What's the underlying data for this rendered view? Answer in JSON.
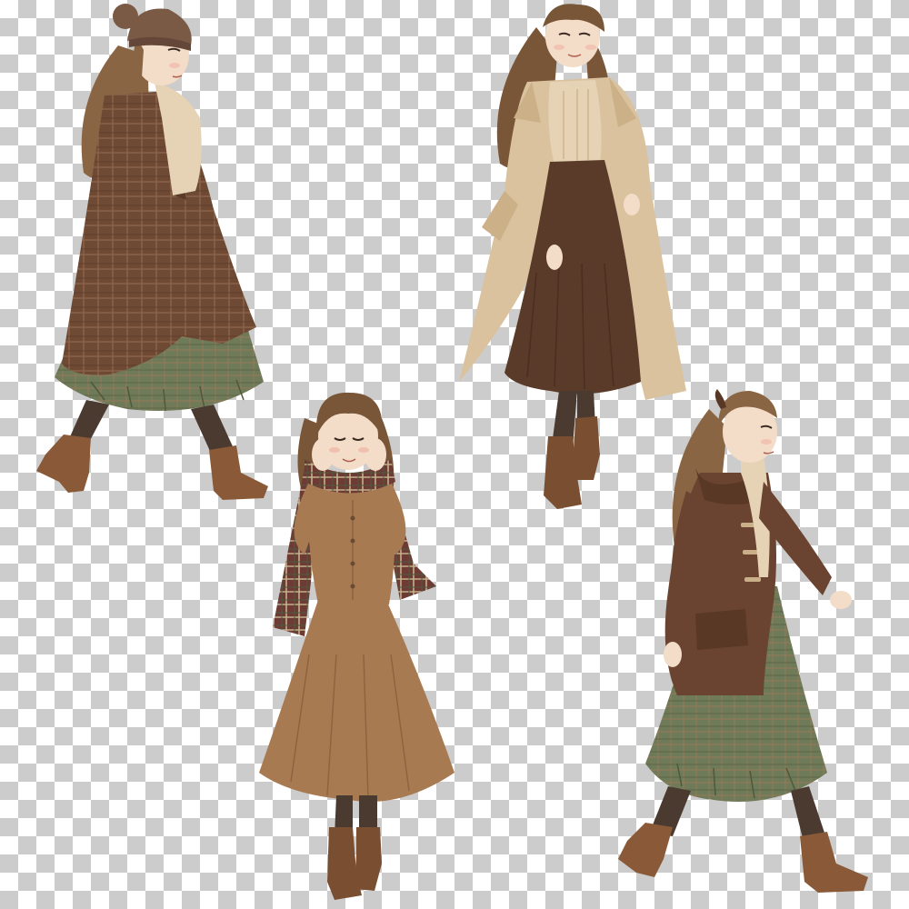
{
  "canvas": {
    "background": "transparency-checkerboard",
    "checker_colors": [
      "#ffffff",
      "#cccccc"
    ]
  },
  "figures": [
    {
      "id": "figure-plaid-coat-beanie",
      "pose": "walking-left",
      "items": [
        "knit-beanie",
        "plaid-wool-coat",
        "cream-sweater",
        "green-plaid-pleated-skirt",
        "brown-tights",
        "heeled-ankle-boots"
      ],
      "colors": {
        "coat": "#6e4a34",
        "skirt": "#6f7a58",
        "sweater": "#e6d2b4",
        "hair": "#8a6544",
        "boots": "#8a5a38",
        "tights": "#4a3a30"
      }
    },
    {
      "id": "figure-trench-coat",
      "pose": "standing-looking-up",
      "items": [
        "beige-trench-coat",
        "cable-knit-sweater",
        "brown-pleated-skirt",
        "brown-tights",
        "ankle-boots"
      ],
      "colors": {
        "coat": "#d9c29d",
        "skirt": "#5a3a28",
        "sweater": "#e6d2b4",
        "hair": "#7a5638",
        "boots": "#7a4e30",
        "tights": "#4a3a30"
      }
    },
    {
      "id": "figure-camel-dress-scarf",
      "pose": "hands-on-cheeks",
      "items": [
        "plaid-scarf",
        "camel-button-front-dress",
        "brown-tights",
        "ankle-boots"
      ],
      "colors": {
        "dress": "#a87a52",
        "scarf": "#6e3a34",
        "hair": "#7a5638",
        "boots": "#7a4e30",
        "tights": "#4a3a30"
      }
    },
    {
      "id": "figure-duffle-coat",
      "pose": "walking-right",
      "items": [
        "hair-ribbon",
        "brown-duffle-coat",
        "turtleneck-sweater",
        "green-plaid-pleated-skirt",
        "brown-tights",
        "heeled-ankle-boots"
      ],
      "colors": {
        "coat": "#6a4430",
        "skirt": "#6f7a58",
        "sweater": "#e6d2b4",
        "hair": "#8a6544",
        "boots": "#8a5a38",
        "tights": "#4a3a30"
      }
    }
  ]
}
